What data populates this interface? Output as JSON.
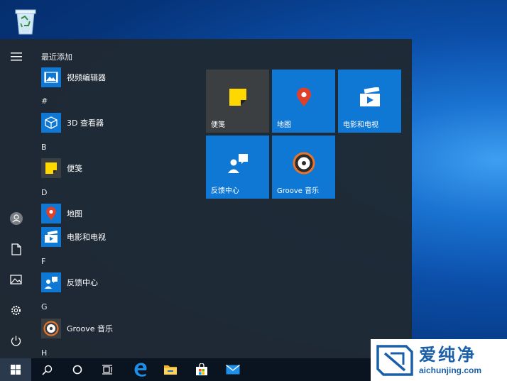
{
  "desktop": {
    "recycle_bin_icon": "recycle-bin-icon"
  },
  "start_menu": {
    "left_rail": {
      "icons": [
        "hamburger-menu-icon",
        "user-avatar-icon",
        "documents-icon",
        "pictures-icon",
        "settings-gear-icon",
        "power-icon"
      ]
    },
    "app_list": {
      "groups": [
        {
          "header": "最近添加",
          "items": [
            {
              "label": "视频编辑器",
              "icon": "video-editor-icon"
            }
          ]
        },
        {
          "header": "#",
          "items": [
            {
              "label": "3D 查看器",
              "icon": "3d-viewer-icon"
            }
          ]
        },
        {
          "header": "B",
          "items": [
            {
              "label": "便笺",
              "icon": "sticky-notes-icon"
            }
          ]
        },
        {
          "header": "D",
          "items": [
            {
              "label": "地图",
              "icon": "maps-icon"
            },
            {
              "label": "电影和电视",
              "icon": "movies-tv-icon"
            }
          ]
        },
        {
          "header": "F",
          "items": [
            {
              "label": "反馈中心",
              "icon": "feedback-hub-icon"
            }
          ]
        },
        {
          "header": "G",
          "items": [
            {
              "label": "Groove 音乐",
              "icon": "groove-music-icon"
            }
          ]
        },
        {
          "header": "H",
          "items": []
        }
      ]
    },
    "tiles": [
      {
        "label": "便笺",
        "icon": "sticky-notes-icon",
        "color": "#3c3f42"
      },
      {
        "label": "地图",
        "icon": "maps-icon",
        "color": "#0f78d4"
      },
      {
        "label": "电影和电视",
        "icon": "movies-tv-icon",
        "color": "#0f78d4"
      },
      {
        "label": "反馈中心",
        "icon": "feedback-hub-icon",
        "color": "#0f78d4"
      },
      {
        "label": "Groove 音乐",
        "icon": "groove-music-icon",
        "color": "#0f78d4"
      }
    ]
  },
  "taskbar": {
    "icons": [
      "windows-start-icon",
      "search-icon",
      "cortana-icon",
      "task-view-icon",
      "edge-browser-icon",
      "file-explorer-icon",
      "microsoft-store-icon",
      "mail-icon"
    ]
  },
  "watermark": {
    "text_cn": "爱纯净",
    "text_en": "aichunjing.com",
    "color": "#1b5fa8"
  },
  "colors": {
    "accent": "#0f78d4",
    "menu_bg": "#1f2933",
    "taskbar_bg": "#0a1420"
  }
}
